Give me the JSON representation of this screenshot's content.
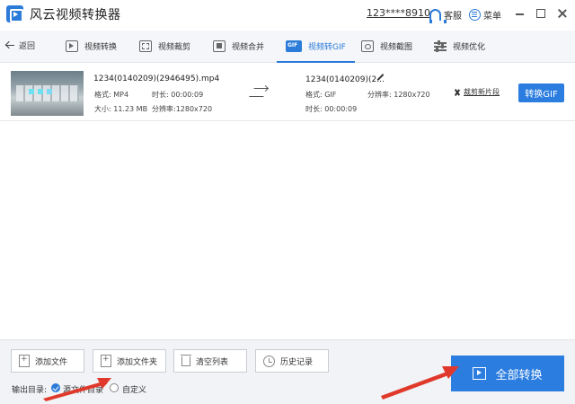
{
  "app": {
    "title": "风云视频转换器"
  },
  "header": {
    "user": "123****8910",
    "service_label": "客服",
    "menu_label": "菜单"
  },
  "nav": {
    "back_label": "返回",
    "tabs": [
      {
        "label": "视频转换",
        "icon": "video-convert-icon",
        "active": false
      },
      {
        "label": "视频裁剪",
        "icon": "video-crop-icon",
        "active": false
      },
      {
        "label": "视频合并",
        "icon": "video-merge-icon",
        "active": false
      },
      {
        "label": "视频转GIF",
        "icon": "gif-icon",
        "active": true
      },
      {
        "label": "视频截图",
        "icon": "screenshot-icon",
        "active": false
      },
      {
        "label": "视频优化",
        "icon": "optimize-icon",
        "active": false
      }
    ]
  },
  "file": {
    "source": {
      "name": "1234(0140209)(2946495).mp4",
      "format": "格式: MP4",
      "duration": "时长: 00:00:09",
      "size": "大小: 11.23 MB",
      "resolution": "分辨率:1280x720"
    },
    "output": {
      "name": "1234(0140209)(2...",
      "format": "格式: GIF",
      "resolution": "分辨率: 1280x720",
      "duration": "时长: 00:00:09"
    },
    "clip_label": "裁剪新片段",
    "convert_label": "转换GIF"
  },
  "toolbar": {
    "add_file": "添加文件",
    "add_folder": "添加文件夹",
    "clear_list": "清空列表",
    "history": "历史记录",
    "output_dir_label": "输出目录:",
    "option_source": "源文件目录",
    "option_custom": "自定义",
    "convert_all": "全部转换"
  },
  "colors": {
    "accent": "#2b7de0",
    "annotation": "#e0392b"
  }
}
